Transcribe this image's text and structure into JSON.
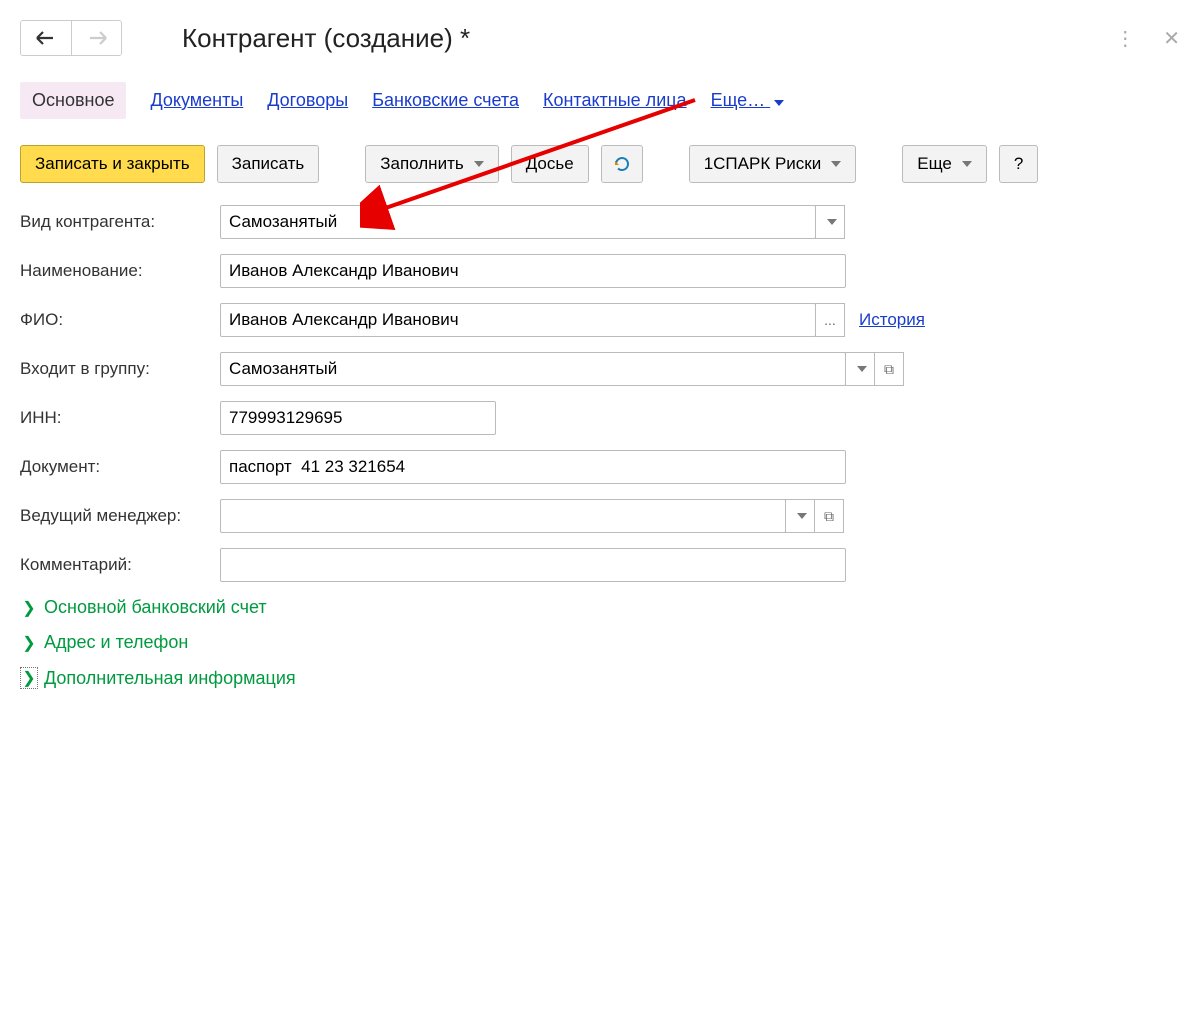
{
  "header": {
    "title": "Контрагент (создание) *"
  },
  "tabs": {
    "main": "Основное",
    "documents": "Документы",
    "contracts": "Договоры",
    "bank_accounts": "Банковские счета",
    "contact_persons": "Контактные лица",
    "more": "Еще…"
  },
  "toolbar": {
    "save_close": "Записать и закрыть",
    "save": "Записать",
    "fill": "Заполнить",
    "dossier": "Досье",
    "spark": "1СПАРК Риски",
    "more": "Еще",
    "help": "?"
  },
  "form": {
    "type_label": "Вид контрагента:",
    "type_value": "Самозанятый",
    "name_label": "Наименование:",
    "name_value": "Иванов Александр Иванович",
    "fio_label": "ФИО:",
    "fio_value": "Иванов Александр Иванович",
    "history_link": "История",
    "group_label": "Входит в группу:",
    "group_value": "Самозанятый",
    "inn_label": "ИНН:",
    "inn_value": "779993129695",
    "document_label": "Документ:",
    "document_value": "паспорт  41 23 321654",
    "manager_label": "Ведущий менеджер:",
    "manager_value": "",
    "comment_label": "Комментарий:",
    "comment_value": ""
  },
  "sections": {
    "bank": "Основной банковский счет",
    "address": "Адрес и телефон",
    "additional": "Дополнительная информация"
  },
  "ellipsis_label": "..."
}
